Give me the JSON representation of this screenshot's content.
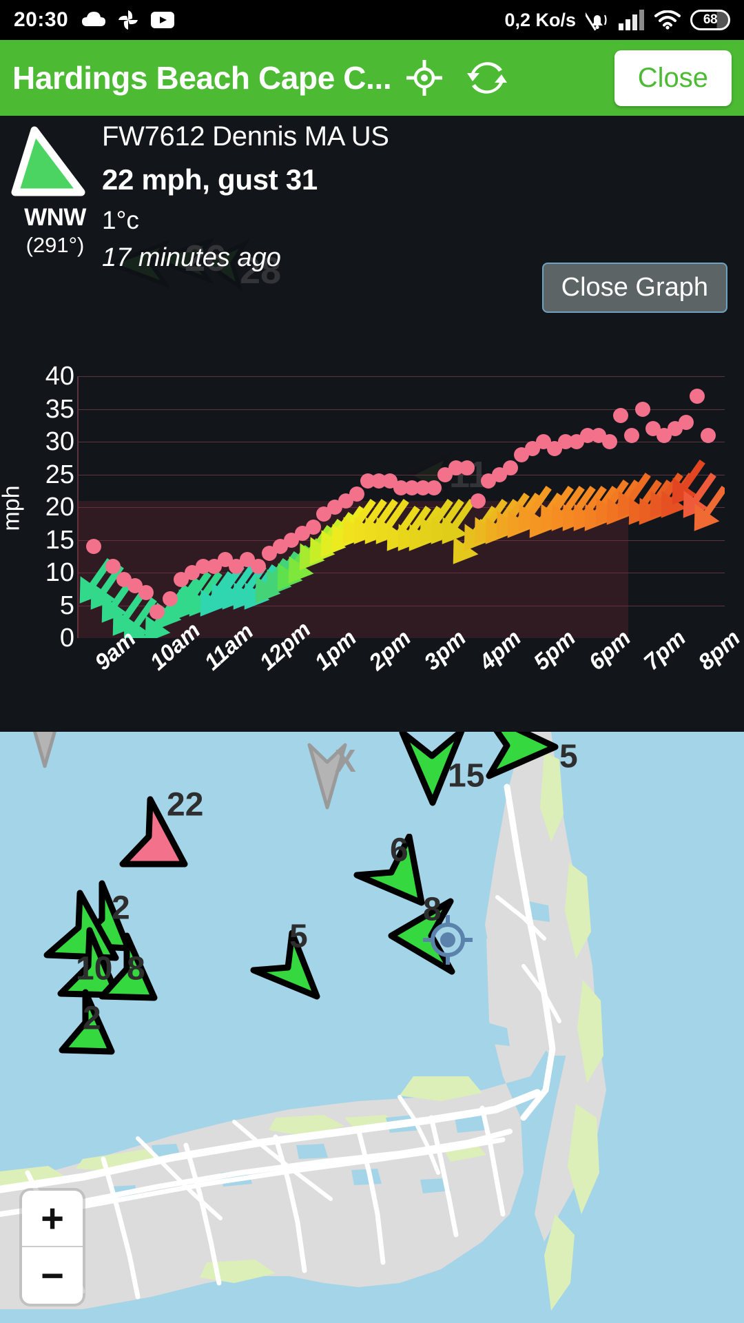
{
  "statusbar": {
    "time": "20:30",
    "icons": [
      "cloud-icon",
      "photos-icon",
      "youtube-icon"
    ],
    "data_rate": "0,2 Ko/s",
    "right_icons": [
      "bell-muted-icon",
      "signal-icon",
      "wifi-icon"
    ],
    "battery": "68"
  },
  "header": {
    "title": "Hardings Beach Cape C...",
    "locate_icon": "crosshair-icon",
    "refresh_icon": "refresh-icon",
    "close_label": "Close"
  },
  "station": {
    "direction_arrow": "wind-direction-arrow",
    "direction_label": "WNW",
    "direction_degrees": "(291°)",
    "name": "FW7612 Dennis MA US",
    "wind": "22 mph, gust 31",
    "temperature": "1°c",
    "updated": "17 minutes ago",
    "close_graph_label": "Close Graph"
  },
  "chart_data": {
    "type": "scatter",
    "title": "",
    "xlabel": "",
    "ylabel": "mph",
    "ylim": [
      0,
      40
    ],
    "yticks": [
      40,
      35,
      30,
      25,
      20,
      15,
      10,
      5,
      0
    ],
    "xtick_labels": [
      "9am",
      "10am",
      "11am",
      "12pm",
      "1pm",
      "2pm",
      "3pm",
      "4pm",
      "5pm",
      "6pm",
      "7pm",
      "8pm"
    ],
    "grid": true,
    "legend": "none",
    "series": [
      {
        "name": "Gust",
        "marker": "dot",
        "color": "#f4718c",
        "x": [
          9.0,
          9.35,
          9.55,
          9.75,
          9.95,
          10.15,
          10.4,
          10.6,
          10.8,
          11.0,
          11.2,
          11.4,
          11.6,
          11.8,
          12.0,
          12.2,
          12.4,
          12.6,
          12.8,
          13.0,
          13.2,
          13.4,
          13.6,
          13.8,
          14.0,
          14.2,
          14.4,
          14.6,
          14.8,
          15.0,
          15.2,
          15.4,
          15.6,
          15.8,
          16.0,
          16.2,
          16.4,
          16.6,
          16.8,
          17.0,
          17.2,
          17.4,
          17.6,
          17.8,
          18.0,
          18.2,
          18.4,
          18.6,
          18.8,
          19.0,
          19.2,
          19.4,
          19.6,
          19.8,
          20.0,
          20.2
        ],
        "y": [
          14,
          11,
          9,
          8,
          7,
          4,
          6,
          9,
          10,
          11,
          11,
          12,
          11,
          12,
          11,
          13,
          14,
          15,
          16,
          17,
          19,
          20,
          21,
          22,
          24,
          24,
          24,
          23,
          23,
          23,
          23,
          25,
          26,
          26,
          21,
          24,
          25,
          26,
          28,
          29,
          30,
          29,
          30,
          30,
          31,
          31,
          30,
          34,
          31,
          35,
          32,
          31,
          32,
          33,
          37,
          31
        ]
      },
      {
        "name": "Wind speed arrows",
        "marker": "arrow",
        "description": "Colored direction arrows rising from ~8 mph (green, morning) through ~20 mph (yellow, midday) to ~26 mph (orange/red, evening)",
        "x": [
          9.0,
          9.2,
          9.4,
          9.6,
          9.8,
          10.0,
          10.2,
          10.4,
          10.6,
          10.8,
          11.0,
          11.2,
          11.4,
          11.6,
          11.8,
          12.0,
          12.2,
          12.4,
          12.6,
          12.8,
          13.0,
          13.2,
          13.4,
          13.6,
          13.8,
          14.0,
          14.2,
          14.4,
          14.6,
          14.8,
          15.0,
          15.2,
          15.4,
          15.6,
          15.8,
          16.0,
          16.2,
          16.4,
          16.6,
          16.8,
          17.0,
          17.2,
          17.4,
          17.6,
          17.8,
          18.0,
          18.2,
          18.4,
          18.6,
          18.8,
          19.0,
          19.2,
          19.4,
          19.6,
          19.8,
          20.0,
          20.2
        ],
        "y": [
          11,
          10,
          8,
          6,
          5,
          3,
          5,
          7,
          8,
          9,
          9,
          9,
          10,
          10,
          10,
          10,
          11,
          12,
          13,
          14,
          16,
          17,
          18,
          19,
          20,
          20,
          20,
          20,
          19,
          19,
          19,
          20,
          20,
          20,
          17,
          19,
          20,
          20,
          21,
          21,
          22,
          21,
          22,
          22,
          22,
          22,
          22,
          23,
          23,
          24,
          23,
          23,
          24,
          24,
          26,
          24,
          22
        ],
        "colors": [
          "#33d98a",
          "#33d98a",
          "#33d98a",
          "#33d98a",
          "#33d98a",
          "#33d98a",
          "#33d98a",
          "#33d98a",
          "#33d98a",
          "#33d98a",
          "#33d98a",
          "#2fd6b0",
          "#2fd6b0",
          "#2fd6b0",
          "#2fd6b0",
          "#2fd6b0",
          "#44d477",
          "#44d477",
          "#5fe04d",
          "#7fe63c",
          "#a8ea2f",
          "#c8ee28",
          "#e1ef22",
          "#edea1f",
          "#f0e31d",
          "#f0df1d",
          "#eedd1c",
          "#ecdb1c",
          "#ebd91c",
          "#e8d61b",
          "#e6d41b",
          "#e4d11b",
          "#e2cf1a",
          "#e0cd1a",
          "#e5c81c",
          "#e8c01e",
          "#ecb81f",
          "#efae20",
          "#f1a621",
          "#f39f22",
          "#f49a22",
          "#f49622",
          "#f59222",
          "#f58d22",
          "#f58922",
          "#f48522",
          "#f38022",
          "#f27b22",
          "#f07422",
          "#ee6d22",
          "#ec6622",
          "#ea5f22",
          "#e85822",
          "#e55122",
          "#e24522",
          "#ef5a3a",
          "#f06a33"
        ]
      }
    ],
    "background_overlay_numbers": [
      "26",
      "28",
      "11"
    ]
  },
  "map": {
    "markers": [
      {
        "value": "5",
        "dir": "east",
        "color": "#35d93f"
      },
      {
        "value": "15",
        "dir": "south",
        "color": "#35d93f"
      },
      {
        "value": "22",
        "dir": "north",
        "color": "#f4718c"
      },
      {
        "value": "6",
        "dir": "southwest",
        "color": "#35d93f"
      },
      {
        "value": "8",
        "dir": "west",
        "color": "#35d93f"
      },
      {
        "value": "2",
        "dir": "north",
        "color": "#35d93f"
      },
      {
        "value": "10",
        "dir": "north",
        "color": "#35d93f"
      },
      {
        "value": "8",
        "dir": "north",
        "color": "#35d93f"
      },
      {
        "value": "5",
        "dir": "west",
        "color": "#35d93f"
      },
      {
        "value": "2",
        "dir": "north",
        "color": "#35d93f"
      },
      {
        "value": "X",
        "dir": "south",
        "color": "#b4b4b4"
      },
      {
        "value": "X",
        "dir": "south",
        "color": "#b4b4b4"
      }
    ],
    "geolocation_icon": "current-location-icon",
    "zoom_in": "+",
    "zoom_out": "−"
  }
}
